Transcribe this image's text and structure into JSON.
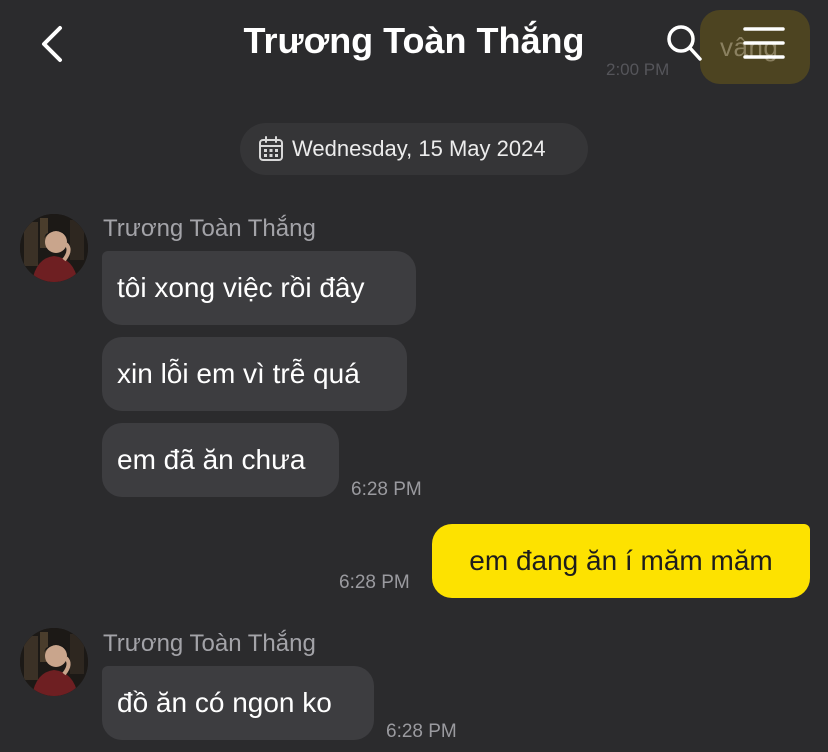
{
  "header": {
    "title": "Trương Toàn Thắng",
    "back_icon": "chevron-left-icon",
    "search_icon": "search-icon",
    "menu_icon": "hamburger-menu-icon",
    "partial_prev_message": "vâng",
    "partial_prev_time": "2:00 PM"
  },
  "date_divider": {
    "icon": "calendar-icon",
    "label": "Wednesday, 15 May 2024"
  },
  "messages": [
    {
      "sender": "Trương Toàn Thắng",
      "bubbles": [
        "tôi xong việc rồi đây",
        "xin lỗi em vì trễ quá",
        "em đã ăn chưa"
      ],
      "time": "6:28 PM"
    },
    {
      "sender": "me",
      "bubbles": [
        "em đang ăn í măm măm"
      ],
      "time": "6:28 PM"
    },
    {
      "sender": "Trương Toàn Thắng",
      "bubbles": [
        "đồ ăn có ngon ko"
      ],
      "time": "6:28 PM"
    }
  ],
  "colors": {
    "background": "#2b2b2d",
    "incoming_bubble": "#3d3d40",
    "outgoing_bubble": "#fde200",
    "title_text": "#ffffff",
    "meta_text": "#9a9a9f"
  }
}
